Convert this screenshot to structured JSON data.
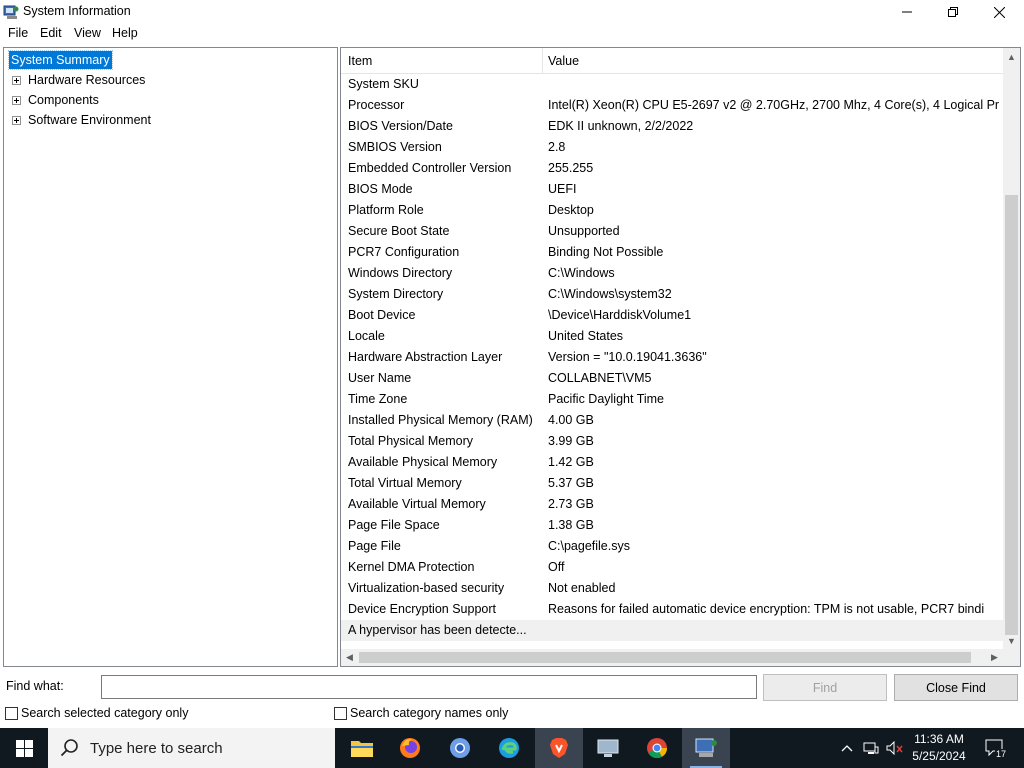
{
  "window": {
    "title": "System Information"
  },
  "menu": [
    "File",
    "Edit",
    "View",
    "Help"
  ],
  "tree": {
    "root": "System Summary",
    "nodes": [
      "Hardware Resources",
      "Components",
      "Software Environment"
    ]
  },
  "list": {
    "columns": [
      "Item",
      "Value"
    ],
    "rows": [
      {
        "item": "System SKU",
        "value": ""
      },
      {
        "item": "Processor",
        "value": "Intel(R) Xeon(R) CPU E5-2697 v2 @ 2.70GHz, 2700 Mhz, 4 Core(s), 4 Logical Pr"
      },
      {
        "item": "BIOS Version/Date",
        "value": "EDK II unknown, 2/2/2022"
      },
      {
        "item": "SMBIOS Version",
        "value": "2.8"
      },
      {
        "item": "Embedded Controller Version",
        "value": "255.255"
      },
      {
        "item": "BIOS Mode",
        "value": "UEFI"
      },
      {
        "item": "Platform Role",
        "value": "Desktop"
      },
      {
        "item": "Secure Boot State",
        "value": "Unsupported"
      },
      {
        "item": "PCR7 Configuration",
        "value": "Binding Not Possible"
      },
      {
        "item": "Windows Directory",
        "value": "C:\\Windows"
      },
      {
        "item": "System Directory",
        "value": "C:\\Windows\\system32"
      },
      {
        "item": "Boot Device",
        "value": "\\Device\\HarddiskVolume1"
      },
      {
        "item": "Locale",
        "value": "United States"
      },
      {
        "item": "Hardware Abstraction Layer",
        "value": "Version = \"10.0.19041.3636\""
      },
      {
        "item": "User Name",
        "value": "COLLABNET\\VM5"
      },
      {
        "item": "Time Zone",
        "value": "Pacific Daylight Time"
      },
      {
        "item": "Installed Physical Memory (RAM)",
        "value": "4.00 GB"
      },
      {
        "item": "Total Physical Memory",
        "value": "3.99 GB"
      },
      {
        "item": "Available Physical Memory",
        "value": "1.42 GB"
      },
      {
        "item": "Total Virtual Memory",
        "value": "5.37 GB"
      },
      {
        "item": "Available Virtual Memory",
        "value": "2.73 GB"
      },
      {
        "item": "Page File Space",
        "value": "1.38 GB"
      },
      {
        "item": "Page File",
        "value": "C:\\pagefile.sys"
      },
      {
        "item": "Kernel DMA Protection",
        "value": "Off"
      },
      {
        "item": "Virtualization-based security",
        "value": "Not enabled"
      },
      {
        "item": "Device Encryption Support",
        "value": "Reasons for failed automatic device encryption: TPM is not usable, PCR7 bindi"
      },
      {
        "item": "A hypervisor has been detecte...",
        "value": ""
      }
    ]
  },
  "find": {
    "label": "Find what:",
    "value": "",
    "find_button": "Find",
    "close_button": "Close Find",
    "option_selected": "Search selected category only",
    "option_names": "Search category names only"
  },
  "taskbar": {
    "search_placeholder": "Type here to search",
    "apps": [
      "file-explorer",
      "firefox",
      "chromium",
      "edge",
      "brave",
      "remote-desktop",
      "chrome",
      "system-information"
    ],
    "time": "11:36 AM",
    "date": "5/25/2024",
    "notifications": "17"
  },
  "colors": {
    "selection": "#0078d7",
    "taskbar": "#101820",
    "search_box": "#f3f3f3"
  }
}
